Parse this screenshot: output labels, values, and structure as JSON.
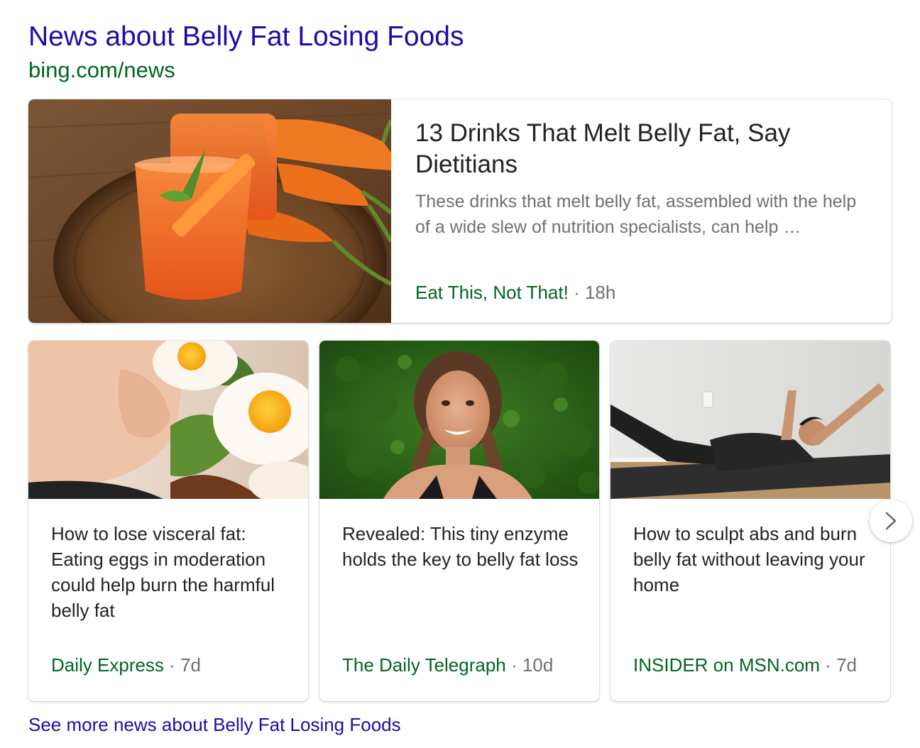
{
  "header": {
    "title": "News about Belly Fat Losing Foods",
    "url": "bing.com/news"
  },
  "featured": {
    "headline": "13 Drinks That Melt Belly Fat, Say Dietitians",
    "snippet": "These drinks that melt belly fat, assembled with the help of a wide slew of nutrition specialists, can help …",
    "source": "Eat This, Not That!",
    "separator": "·",
    "age": "18h",
    "image_icon": "carrot-juice-photo"
  },
  "cards": [
    {
      "headline": "How to lose visceral fat: Eating eggs in moderation could help burn the harmful belly fat",
      "source": "Daily Express",
      "separator": "·",
      "age": "7d",
      "image_icon": "belly-and-eggs-photo"
    },
    {
      "headline": "Revealed: This tiny enzyme holds the key to belly fat loss",
      "source": "The Daily Telegraph",
      "separator": "·",
      "age": "10d",
      "image_icon": "woman-portrait-photo"
    },
    {
      "headline": "How to sculpt abs and burn belly fat without leaving your home",
      "source": "INSIDER on MSN.com",
      "separator": "·",
      "age": "7d",
      "image_icon": "man-exercising-photo"
    }
  ],
  "navigation": {
    "next_icon": "chevron-right-icon"
  },
  "footer": {
    "more_link": "See more news about Belly Fat Losing Foods"
  },
  "colors": {
    "link": "#1a0dab",
    "url": "#006621",
    "source": "#006621",
    "meta": "#707070",
    "headline": "#222222"
  }
}
